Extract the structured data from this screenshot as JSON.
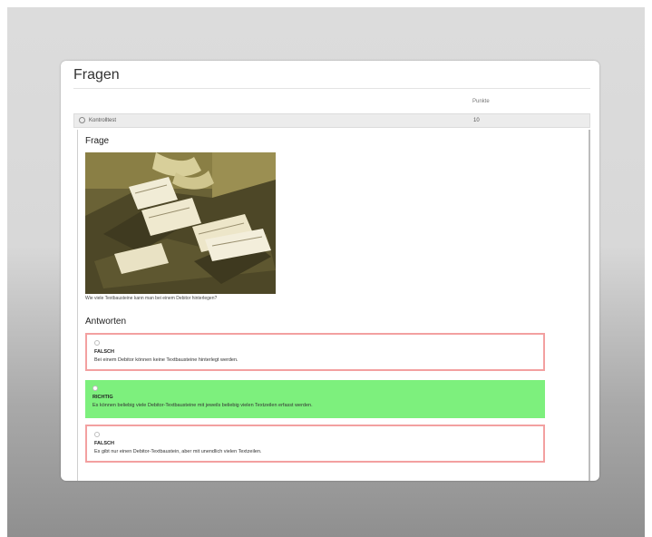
{
  "page": {
    "title": "Fragen"
  },
  "table": {
    "column_header": "Punkte",
    "question": {
      "name": "Kontrolltest",
      "points": "10"
    }
  },
  "detail": {
    "frage_heading": "Frage",
    "question_text": "Wie viele Textbausteine kann man bei einem Debitor hinterlegen?",
    "answers_heading": "Antworten",
    "answers": [
      {
        "verdict": "FALSCH",
        "text": "Bei einem Debitor können keine Textbausteine hinterlegt werden.",
        "correct": false
      },
      {
        "verdict": "RICHTIG",
        "text": "Es können beliebig viele Debitor-Textbausteine mit jeweils beliebig vielen Textzeilen erfasst werden.",
        "correct": true
      },
      {
        "verdict": "FALSCH",
        "text": "Es gibt nur einen Debitor-Textbaustein, aber mit unendlich vielen Textzeilen.",
        "correct": false
      }
    ]
  },
  "colors": {
    "correct_bg": "#7df07d",
    "wrong_border": "#f3a0a0",
    "photo_tint": "#c9b85a"
  }
}
